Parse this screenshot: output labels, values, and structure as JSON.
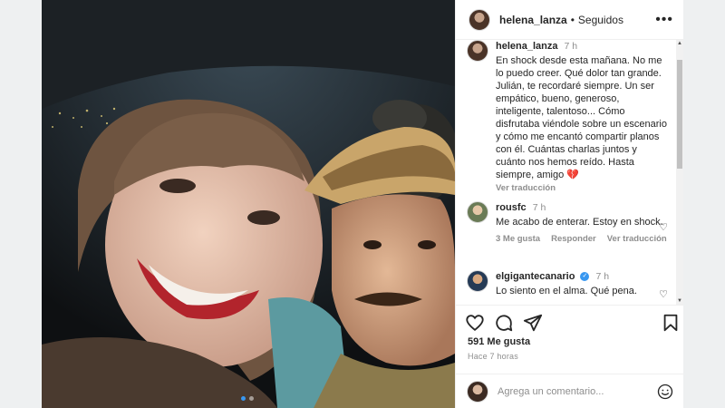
{
  "header": {
    "username": "helena_lanza",
    "separator": "•",
    "follow_status": "Seguidos",
    "more_icon": "more-horizontal-icon"
  },
  "caption": {
    "username": "helena_lanza",
    "time": "7 h",
    "text": "En shock desde esta mañana. No me lo puedo creer. Qué dolor tan grande. Julián, te recordaré siempre. Un ser empático, bueno, generoso, inteligente, talentoso... Cómo disfrutaba viéndole sobre un escenario y cómo me encantó compartir planos con él. Cuántas charlas juntos y cuánto nos hemos reído. Hasta siempre, amigo",
    "emoji": "💔",
    "see_translation": "Ver traducción"
  },
  "comments": [
    {
      "username": "rousfc",
      "time": "7 h",
      "text": "Me acabo de enterar. Estoy en shock.",
      "likes": "3 Me gusta",
      "reply": "Responder",
      "translate": "Ver traducción"
    },
    {
      "username": "elgigantecanario",
      "verified": true,
      "time": "7 h",
      "text": "Lo siento en el alma. Qué pena."
    }
  ],
  "actions": {
    "like_icon": "heart-icon",
    "comment_icon": "comment-icon",
    "share_icon": "send-icon",
    "save_icon": "bookmark-icon"
  },
  "likes_count": "591 Me gusta",
  "post_time": "Hace 7 horas",
  "add_comment": {
    "placeholder": "Agrega un comentario...",
    "emoji_icon": "smiley-icon"
  },
  "carousel": {
    "next_icon": "chevron-right-icon",
    "total_slides": 2,
    "active_slide": 1
  },
  "colors": {
    "accent": "#3897f0",
    "text": "#262626",
    "muted": "#8e8e8e",
    "border": "#efefef"
  }
}
